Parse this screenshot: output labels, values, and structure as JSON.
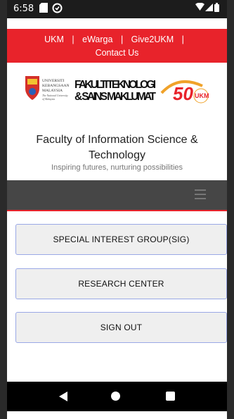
{
  "status": {
    "time": "6:58"
  },
  "topnav": {
    "links": [
      "UKM",
      "eWarga",
      "Give2UKM",
      "Contact Us"
    ],
    "separator": "|"
  },
  "logo": {
    "ukm_lines": [
      "UNIVERSITI",
      "KEBANGSAAN",
      "MALAYSIA"
    ],
    "ukm_sub": [
      "The National University",
      "of Malaysia"
    ],
    "faculty_line1": "FAKULTI TEKNOLOGI",
    "faculty_line2": "& SAINS MAKLUMAT",
    "anniv_number": "50",
    "anniv_tag": "UKM"
  },
  "header": {
    "title": "Faculty of Information Science & Technology",
    "tagline": "Inspiring futures, nurturing possibilities"
  },
  "buttons": {
    "sig": "SPECIAL INTEREST GROUP(SIG)",
    "research": "RESEARCH CENTER",
    "signout": "SIGN OUT"
  },
  "colors": {
    "brand_red": "#e8232b",
    "menubar": "#464646",
    "button_border": "#9aa8e6"
  }
}
